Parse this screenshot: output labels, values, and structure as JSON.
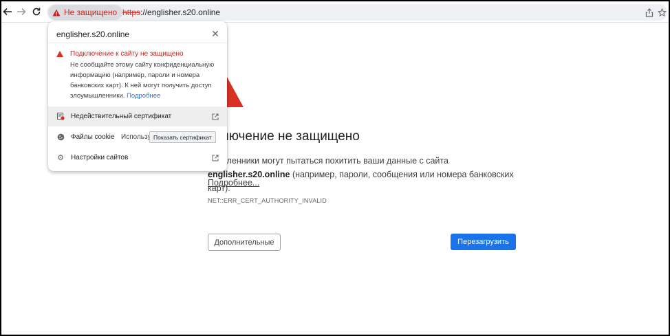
{
  "browser": {
    "security_chip_label": "Не защищено",
    "url_scheme": "https",
    "url_rest": "://englisher.s20.online"
  },
  "popup": {
    "site": "englisher.s20.online",
    "warning_title": "Подключение к сайту не защищено",
    "warning_body": "Не сообщайте этому сайту конфиденциальную информацию (например, пароли и номера банковских карт). К ней могут получить доступ злоумышленники.",
    "warning_more": "Подробнее",
    "rows": [
      {
        "label": "Недействительный сертификат"
      },
      {
        "label": "Файлы cookie",
        "extra": "Использу"
      },
      {
        "label": "Настройки сайтов"
      }
    ]
  },
  "tooltip": "Показать сертификат",
  "page": {
    "title": "дключение не защищено",
    "body_line1": "мышленники могут пытаться похитить ваши данные с сайта",
    "body_domain": "englisher.s20.online",
    "body_line2": " (например, пароли, сообщения или номера банковских карт).",
    "more_link": "Подробнее...",
    "error_code": "NET::ERR_CERT_AUTHORITY_INVALID",
    "advanced_button": "Дополнительные",
    "reload_button": "Перезагрузить"
  },
  "colors": {
    "danger": "#d93025",
    "accent": "#1a73e8"
  }
}
